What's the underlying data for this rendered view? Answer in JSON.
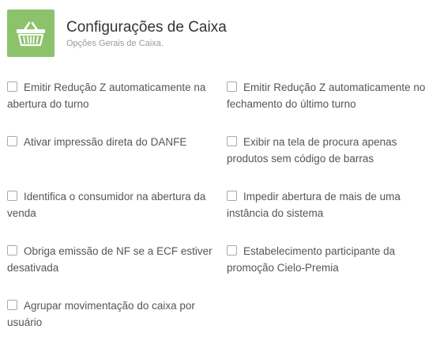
{
  "header": {
    "title": "Configurações de Caixa",
    "subtitle": "Opções Gerais de Caixa.",
    "icon": "basket-icon",
    "icon_bg": "#8cc26c"
  },
  "options": [
    {
      "label": "Emitir Redução Z automaticamente na abertura do turno",
      "checked": false
    },
    {
      "label": "Emitir Redução Z automaticamente no fechamento do último turno",
      "checked": false
    },
    {
      "label": "Ativar impressão direta do DANFE",
      "checked": false
    },
    {
      "label": "Exibir na tela de procura apenas produtos sem código de barras",
      "checked": false
    },
    {
      "label": "Identifica o consumidor na abertura da venda",
      "checked": false
    },
    {
      "label": "Impedir abertura de mais de uma instância do sistema",
      "checked": false
    },
    {
      "label": "Obriga emissão de NF se a ECF estiver desativada",
      "checked": false
    },
    {
      "label": "Estabelecimento participante da promoção Cielo-Premia",
      "checked": false
    },
    {
      "label": "Agrupar movimentação do caixa por usuário",
      "checked": false
    }
  ]
}
